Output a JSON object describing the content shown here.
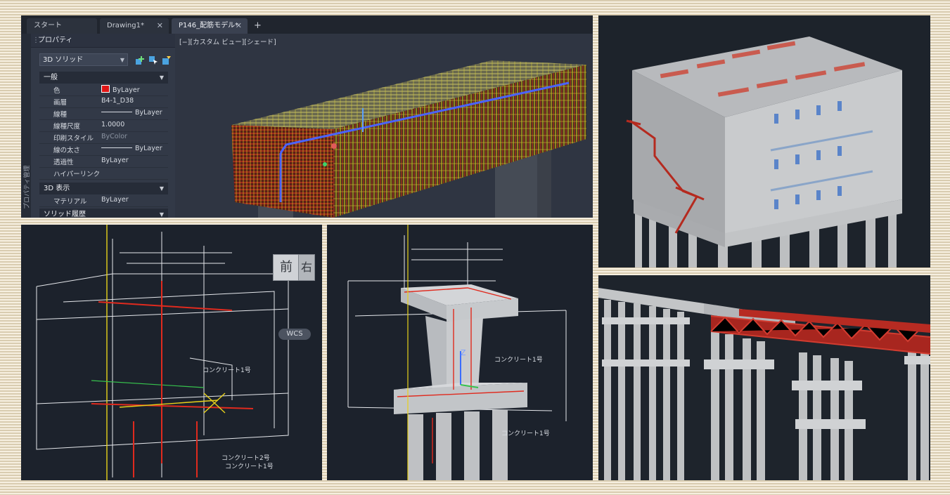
{
  "app": {
    "tabs": [
      {
        "label": "スタート",
        "closable": false
      },
      {
        "label": "Drawing1*",
        "closable": true
      },
      {
        "label": "P146_配筋モデル*",
        "closable": true
      }
    ],
    "new_tab_symbol": "+",
    "close_symbol": "✕",
    "properties": {
      "panel_title": "プロパティ",
      "sidebar_label": "プロパティ管理",
      "object_type": "3D ソリッド",
      "sections": [
        {
          "title": "一般",
          "rows": [
            {
              "key": "色",
              "value": "ByLayer",
              "swatch": "#e01616"
            },
            {
              "key": "画層",
              "value": "B4-1_D38"
            },
            {
              "key": "線種",
              "value": "ByLayer",
              "line": true
            },
            {
              "key": "線種尺度",
              "value": "1.0000"
            },
            {
              "key": "印刷スタイル",
              "value": "ByColor",
              "dim": true
            },
            {
              "key": "線の太さ",
              "value": "ByLayer",
              "line": true
            },
            {
              "key": "透過性",
              "value": "ByLayer"
            },
            {
              "key": "ハイパーリンク",
              "value": ""
            }
          ]
        },
        {
          "title": "3D 表示",
          "rows": [
            {
              "key": "マテリアル",
              "value": "ByLayer"
            }
          ]
        },
        {
          "title": "ソリッド履歴",
          "rows": []
        }
      ]
    },
    "viewport_label": "[−][カスタム ビュー][シェード]"
  },
  "drawing1": {
    "viewcube_front": "前",
    "viewcube_right": "右",
    "wcs_label": "WCS",
    "label_concrete": "コンクリート1号",
    "label_concrete_2": "コンクリート2号",
    "label_concrete_3": "コンクリート1号"
  },
  "drawing2": {
    "axis_z": "Z",
    "label_concrete": "コンクリート1号",
    "label_concrete_low": "コンクリート1号"
  },
  "colors": {
    "rebar_red": "#d42a1c",
    "rebar_yellow": "#e8d21a",
    "steel_red": "#b3211d",
    "concrete_gray": "#bfc1c3",
    "cad_background": "#1c222c"
  }
}
